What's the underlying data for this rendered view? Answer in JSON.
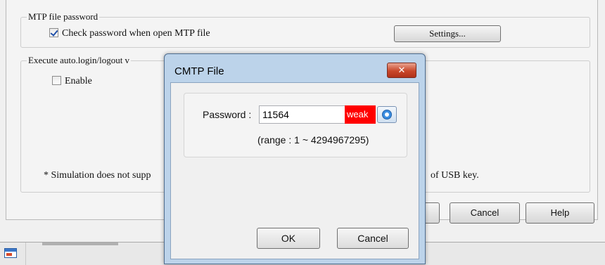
{
  "background_panel": {
    "mtp_group": {
      "legend": "MTP file password",
      "checkbox_label": "Check password when open MTP file",
      "checkbox_checked": true,
      "settings_button": "Settings..."
    },
    "auto_login_group": {
      "legend": "Execute auto.login/logout v",
      "enable_label": "Enable",
      "enable_checked": false,
      "note_left": "* Simulation does not supp",
      "note_right": "of USB key."
    },
    "bottom_buttons": {
      "cancel": "Cancel",
      "help": "Help"
    }
  },
  "dialog": {
    "title": "CMTP File",
    "close_glyph": "✕",
    "password_label": "Password :",
    "password_value": "11564",
    "strength_label": "weak",
    "strength_color": "#ff0000",
    "range_text": "(range : 1 ~ 4294967295)",
    "ok_button": "OK",
    "cancel_button": "Cancel"
  },
  "icons": {
    "taskbar_app": "app-window-icon",
    "show_password": "eye-icon",
    "checkbox_tick": "check-icon"
  }
}
